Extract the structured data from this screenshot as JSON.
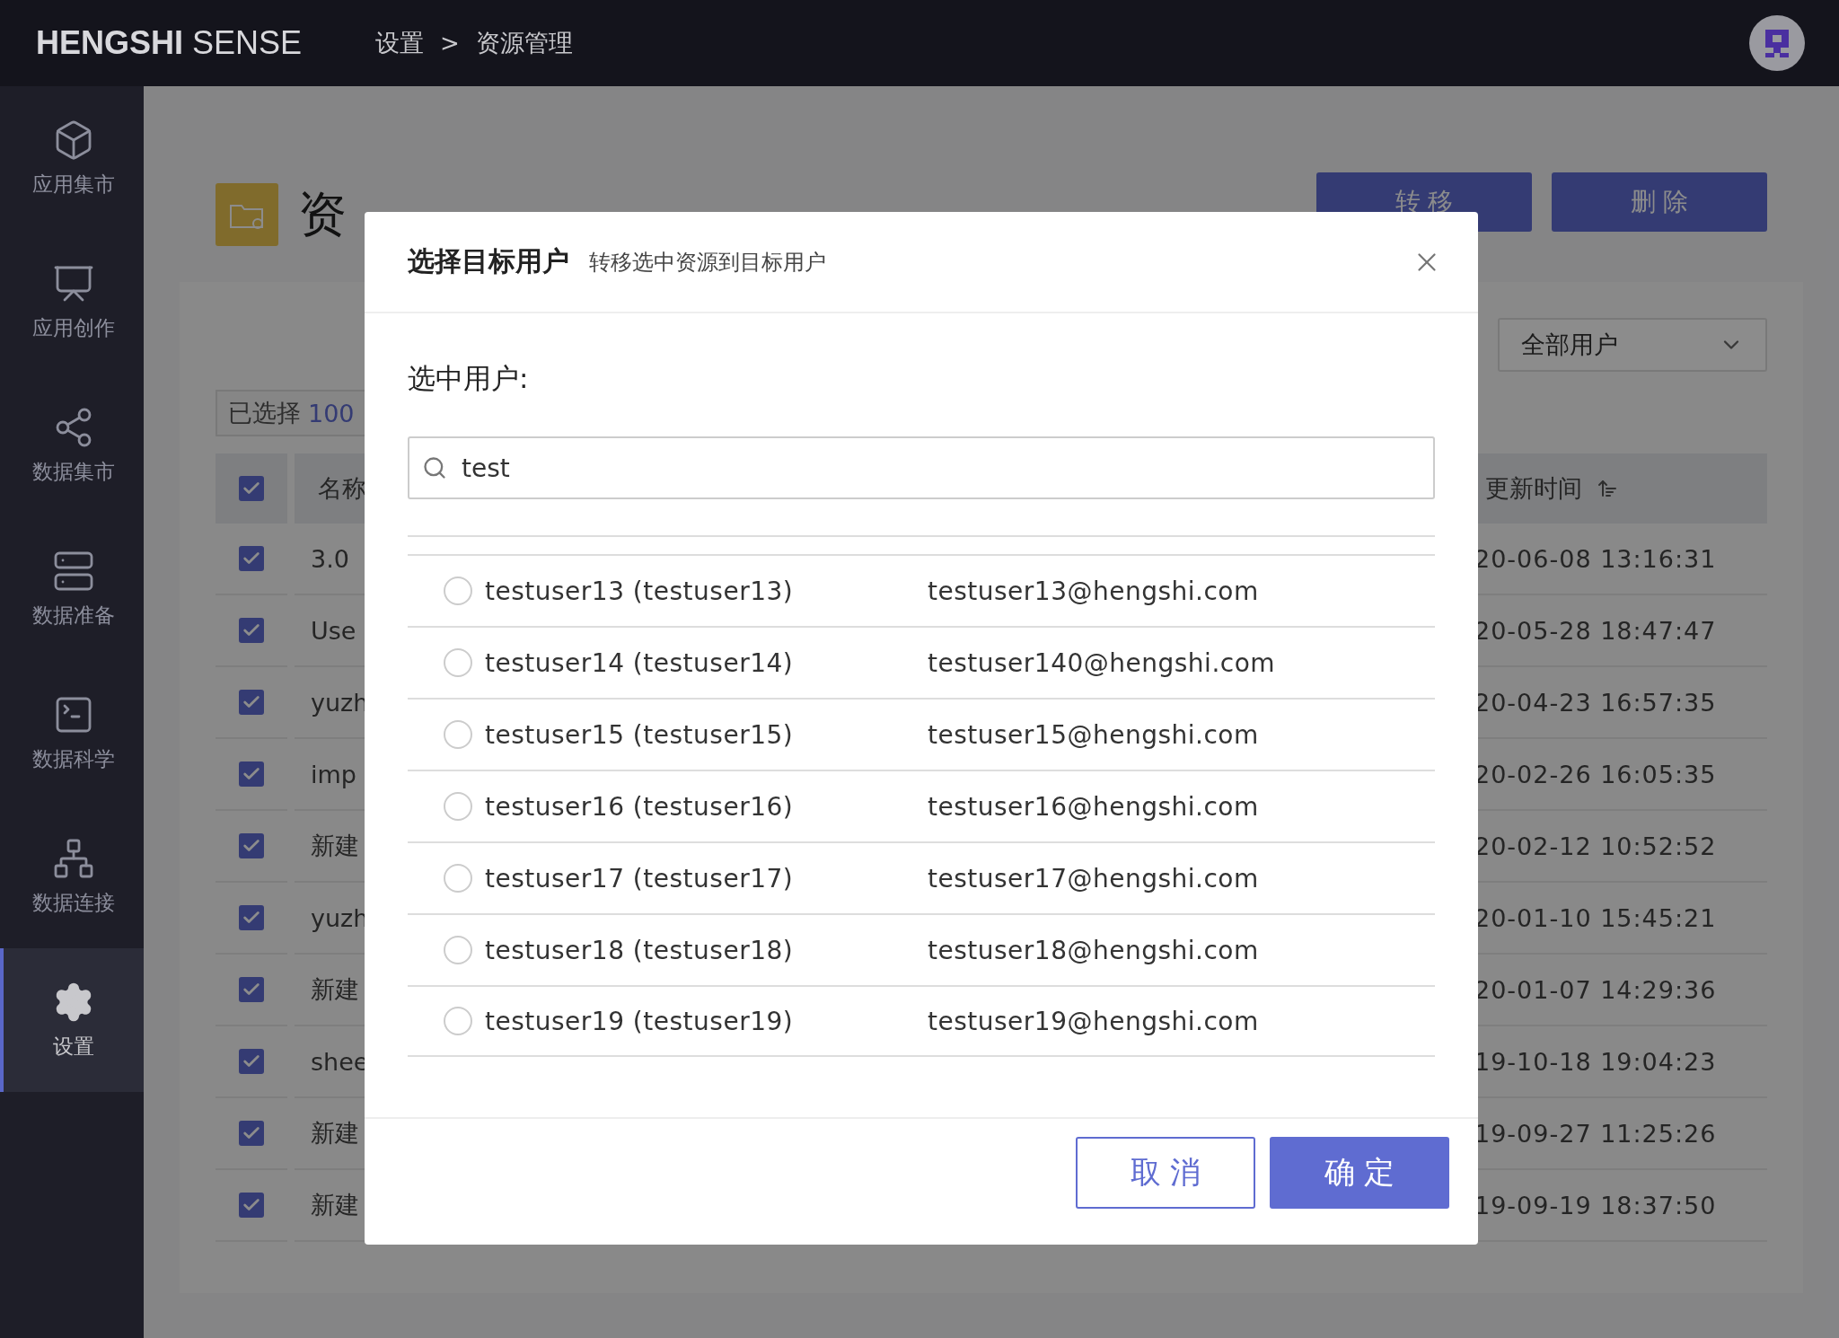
{
  "header": {
    "brand_bold": "HENGSHI",
    "brand_light": "SENSE",
    "breadcrumb": [
      "设置",
      "资源管理"
    ],
    "separator": ">"
  },
  "sidebar": {
    "items": [
      {
        "label": "应用集市",
        "selected": false
      },
      {
        "label": "应用创作",
        "selected": false
      },
      {
        "label": "数据集市",
        "selected": false
      },
      {
        "label": "数据准备",
        "selected": false
      },
      {
        "label": "数据科学",
        "selected": false
      },
      {
        "label": "数据连接",
        "selected": false
      },
      {
        "label": "设置",
        "selected": true
      }
    ]
  },
  "page": {
    "title": "资",
    "actions": [
      "转 移",
      "删 除"
    ],
    "selection": {
      "label": "已选择",
      "count": "100"
    },
    "filter": {
      "value": "全部用户"
    },
    "table": {
      "header_checked": true,
      "columns": [
        "名称",
        "更新时间"
      ],
      "rows": [
        {
          "checked": true,
          "name": "3.0",
          "updated": "20-06-08 13:16:31"
        },
        {
          "checked": true,
          "name": "Use",
          "updated": "20-05-28 18:47:47"
        },
        {
          "checked": true,
          "name": "yuzh",
          "updated": "20-04-23 16:57:35"
        },
        {
          "checked": true,
          "name": "imp",
          "updated": "20-02-26 16:05:35"
        },
        {
          "checked": true,
          "name": "新建",
          "updated": "20-02-12 10:52:52"
        },
        {
          "checked": true,
          "name": "yuzh",
          "updated": "20-01-10 15:45:21"
        },
        {
          "checked": true,
          "name": "新建",
          "updated": "20-01-07 14:29:36"
        },
        {
          "checked": true,
          "name": "shee",
          "updated": "19-10-18 19:04:23"
        },
        {
          "checked": true,
          "name": "新建",
          "updated": "19-09-27 11:25:26"
        },
        {
          "checked": true,
          "name": "新建",
          "updated": "19-09-19 18:37:50"
        }
      ]
    }
  },
  "dialog": {
    "title": "选择目标用户",
    "subtitle": "转移选中资源到目标用户",
    "field_label": "选中用户:",
    "search": {
      "value": "test"
    },
    "users": [
      {
        "name": "testuser13 (testuser13)",
        "email": "testuser13@hengshi.com",
        "selected": false
      },
      {
        "name": "testuser14 (testuser14)",
        "email": "testuser140@hengshi.com",
        "selected": false
      },
      {
        "name": "testuser15 (testuser15)",
        "email": "testuser15@hengshi.com",
        "selected": false
      },
      {
        "name": "testuser16 (testuser16)",
        "email": "testuser16@hengshi.com",
        "selected": false
      },
      {
        "name": "testuser17 (testuser17)",
        "email": "testuser17@hengshi.com",
        "selected": false
      },
      {
        "name": "testuser18 (testuser18)",
        "email": "testuser18@hengshi.com",
        "selected": false
      },
      {
        "name": "testuser19 (testuser19)",
        "email": "testuser19@hengshi.com",
        "selected": false
      }
    ],
    "buttons": [
      {
        "label": "取 消",
        "kind": "secondary"
      },
      {
        "label": "确 定",
        "kind": "primary"
      }
    ]
  }
}
